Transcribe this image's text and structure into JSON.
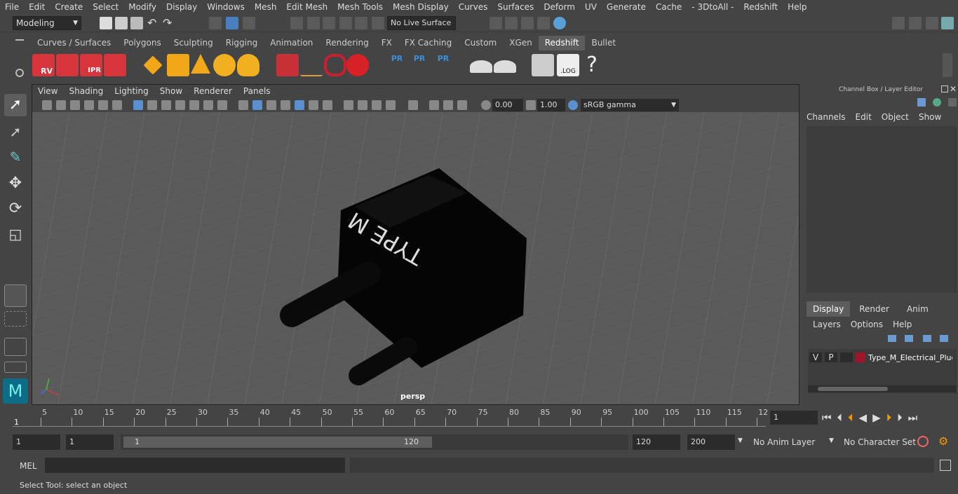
{
  "menu": {
    "file": "File",
    "edit": "Edit",
    "create": "Create",
    "select": "Select",
    "modify": "Modify",
    "display": "Display",
    "windows": "Windows",
    "mesh": "Mesh",
    "edit_mesh": "Edit Mesh",
    "mesh_tools": "Mesh Tools",
    "mesh_display": "Mesh Display",
    "curves": "Curves",
    "surfaces": "Surfaces",
    "deform": "Deform",
    "uv": "UV",
    "generate": "Generate",
    "cache": "Cache",
    "threedtoall": "- 3DtoAll -",
    "redshift": "Redshift",
    "help": "Help"
  },
  "status": {
    "mode": "Modeling",
    "live_surface": "No Live Surface"
  },
  "shelf_tabs": [
    "Curves / Surfaces",
    "Polygons",
    "Sculpting",
    "Rigging",
    "Animation",
    "Rendering",
    "FX",
    "FX Caching",
    "Custom",
    "XGen",
    "Redshift",
    "Bullet"
  ],
  "shelf_active": "Redshift",
  "shelf_labels": {
    "rv": "RV",
    "ipr": "IPR",
    "pr1": "PR",
    "pr2": "PR",
    "pr3": "PR",
    "log": ".LOG",
    "help": "?"
  },
  "viewport": {
    "menu": [
      "View",
      "Shading",
      "Lighting",
      "Show",
      "Renderer",
      "Panels"
    ],
    "exposure": "0.00",
    "gamma": "1.00",
    "color_space": "sRGB gamma",
    "camera": "persp",
    "model_label": "TYPE M"
  },
  "channel_box": {
    "title": "Channel Box / Layer Editor",
    "menu": [
      "Channels",
      "Edit",
      "Object",
      "Show"
    ]
  },
  "layer_editor": {
    "tabs": [
      "Display",
      "Render",
      "Anim"
    ],
    "active_tab": "Display",
    "menu": [
      "Layers",
      "Options",
      "Help"
    ],
    "layer": {
      "v": "V",
      "p": "P",
      "name": "Type_M_Electrical_Plug",
      "color": "#a0142c"
    }
  },
  "timeline": {
    "ticks": [
      "5",
      "10",
      "15",
      "20",
      "25",
      "30",
      "35",
      "40",
      "45",
      "50",
      "55",
      "60",
      "65",
      "70",
      "75",
      "80",
      "85",
      "90",
      "95",
      "100",
      "105",
      "110",
      "115",
      "12"
    ],
    "start_marker": "1",
    "current_frame": "1"
  },
  "range": {
    "start": "1",
    "playback_start": "1",
    "slider_start": "1",
    "slider_end": "120",
    "playback_end": "120",
    "end": "200",
    "anim_layer": "No Anim Layer",
    "char_set": "No Character Set"
  },
  "cmd": {
    "label": "MEL"
  },
  "help_line": "Select Tool: select an object"
}
